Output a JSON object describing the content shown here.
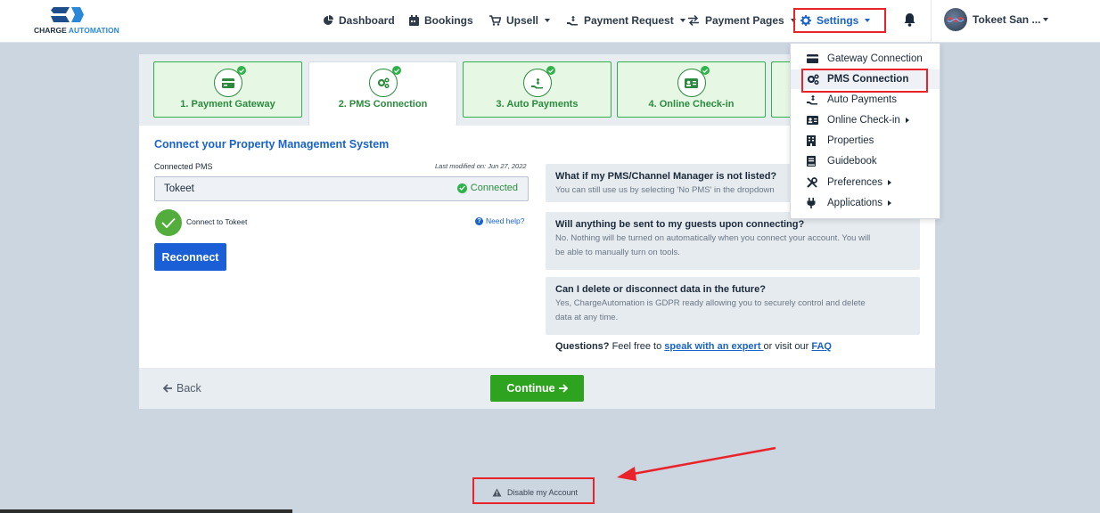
{
  "brand": {
    "name_part1": "CHARGE",
    "name_part2": "AUTOMATION"
  },
  "nav": {
    "items": [
      {
        "label": "Dashboard",
        "icon": "dashboard-icon"
      },
      {
        "label": "Bookings",
        "icon": "calendar-icon"
      },
      {
        "label": "Upsell",
        "icon": "cart-icon"
      },
      {
        "label": "Payment Request",
        "icon": "hand-dollar-icon"
      },
      {
        "label": "Payment Pages",
        "icon": "exchange-icon"
      },
      {
        "label": "Settings",
        "icon": "gear-icon"
      }
    ],
    "user_name": "Tokeet San ..."
  },
  "steps": [
    {
      "label": "1. Payment Gateway",
      "icon": "credit-card-icon",
      "completed": true
    },
    {
      "label": "2. PMS Connection",
      "icon": "gears-icon",
      "completed": true,
      "active": true
    },
    {
      "label": "3. Auto Payments",
      "icon": "hand-dollar-icon",
      "completed": true
    },
    {
      "label": "4. Online Check-in",
      "icon": "id-card-icon",
      "completed": true
    }
  ],
  "connect": {
    "title": "Connect your Property Management System",
    "field_label": "Connected PMS",
    "last_modified": "Last modified on: Jun 27, 2022",
    "pms_value": "Tokeet",
    "status": "Connected",
    "connect_label": "Connect to Tokeet",
    "need_help": "Need help?",
    "reconnect_label": "Reconnect"
  },
  "faqs": [
    {
      "question": "What if my PMS/Channel Manager is not listed?",
      "answer": "You can still use us by selecting 'No PMS' in the dropdown"
    },
    {
      "question": "Will anything be sent to my guests upon connecting?",
      "answer_line1": "No. Nothing will be turned on automatically when you connect your account. You will",
      "answer_line2": "be able to manually turn on tools."
    },
    {
      "question": "Can I delete or disconnect data in the future?",
      "answer_line1": "Yes, ChargeAutomation is GDPR ready allowing you to securely control and delete",
      "answer_line2": "data at any time."
    }
  ],
  "questions": {
    "prefix": "Questions?",
    "text1": " Feel free to ",
    "link1": "speak with an expert ",
    "text2": "or visit our ",
    "link2": "FAQ"
  },
  "footer": {
    "back_label": "Back",
    "continue_label": "Continue"
  },
  "settings_menu": [
    {
      "label": "Gateway Connection",
      "icon": "credit-card-icon"
    },
    {
      "label": "PMS Connection",
      "icon": "gears-icon",
      "highlighted": true
    },
    {
      "label": "Auto Payments",
      "icon": "hand-dollar-icon"
    },
    {
      "label": "Online Check-in",
      "icon": "id-card-icon",
      "submenu": true
    },
    {
      "label": "Properties",
      "icon": "building-icon"
    },
    {
      "label": "Guidebook",
      "icon": "book-icon"
    },
    {
      "label": "Preferences",
      "icon": "tools-icon",
      "submenu": true
    },
    {
      "label": "Applications",
      "icon": "plug-icon",
      "submenu": true
    }
  ],
  "disable_account": "Disable my Account",
  "colors": {
    "accent": "#1a63c9",
    "success": "#2fb24a",
    "annotation": "#e8242a",
    "background": "#ccd6e1"
  }
}
